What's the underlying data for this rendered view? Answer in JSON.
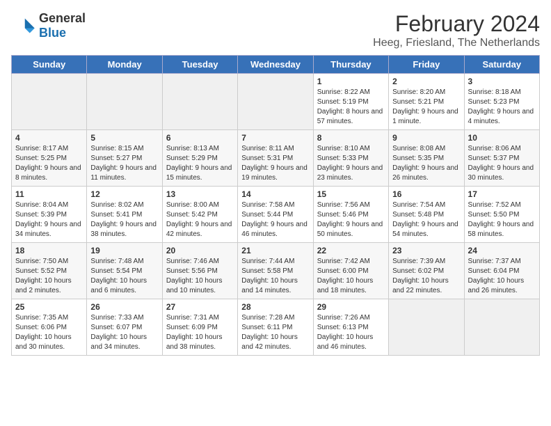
{
  "header": {
    "logo_general": "General",
    "logo_blue": "Blue",
    "month": "February 2024",
    "location": "Heeg, Friesland, The Netherlands"
  },
  "weekdays": [
    "Sunday",
    "Monday",
    "Tuesday",
    "Wednesday",
    "Thursday",
    "Friday",
    "Saturday"
  ],
  "weeks": [
    [
      {
        "day": "",
        "empty": true
      },
      {
        "day": "",
        "empty": true
      },
      {
        "day": "",
        "empty": true
      },
      {
        "day": "",
        "empty": true
      },
      {
        "day": "1",
        "sunrise": "8:22 AM",
        "sunset": "5:19 PM",
        "daylight": "8 hours and 57 minutes."
      },
      {
        "day": "2",
        "sunrise": "8:20 AM",
        "sunset": "5:21 PM",
        "daylight": "9 hours and 1 minute."
      },
      {
        "day": "3",
        "sunrise": "8:18 AM",
        "sunset": "5:23 PM",
        "daylight": "9 hours and 4 minutes."
      }
    ],
    [
      {
        "day": "4",
        "sunrise": "8:17 AM",
        "sunset": "5:25 PM",
        "daylight": "9 hours and 8 minutes."
      },
      {
        "day": "5",
        "sunrise": "8:15 AM",
        "sunset": "5:27 PM",
        "daylight": "9 hours and 11 minutes."
      },
      {
        "day": "6",
        "sunrise": "8:13 AM",
        "sunset": "5:29 PM",
        "daylight": "9 hours and 15 minutes."
      },
      {
        "day": "7",
        "sunrise": "8:11 AM",
        "sunset": "5:31 PM",
        "daylight": "9 hours and 19 minutes."
      },
      {
        "day": "8",
        "sunrise": "8:10 AM",
        "sunset": "5:33 PM",
        "daylight": "9 hours and 23 minutes."
      },
      {
        "day": "9",
        "sunrise": "8:08 AM",
        "sunset": "5:35 PM",
        "daylight": "9 hours and 26 minutes."
      },
      {
        "day": "10",
        "sunrise": "8:06 AM",
        "sunset": "5:37 PM",
        "daylight": "9 hours and 30 minutes."
      }
    ],
    [
      {
        "day": "11",
        "sunrise": "8:04 AM",
        "sunset": "5:39 PM",
        "daylight": "9 hours and 34 minutes."
      },
      {
        "day": "12",
        "sunrise": "8:02 AM",
        "sunset": "5:41 PM",
        "daylight": "9 hours and 38 minutes."
      },
      {
        "day": "13",
        "sunrise": "8:00 AM",
        "sunset": "5:42 PM",
        "daylight": "9 hours and 42 minutes."
      },
      {
        "day": "14",
        "sunrise": "7:58 AM",
        "sunset": "5:44 PM",
        "daylight": "9 hours and 46 minutes."
      },
      {
        "day": "15",
        "sunrise": "7:56 AM",
        "sunset": "5:46 PM",
        "daylight": "9 hours and 50 minutes."
      },
      {
        "day": "16",
        "sunrise": "7:54 AM",
        "sunset": "5:48 PM",
        "daylight": "9 hours and 54 minutes."
      },
      {
        "day": "17",
        "sunrise": "7:52 AM",
        "sunset": "5:50 PM",
        "daylight": "9 hours and 58 minutes."
      }
    ],
    [
      {
        "day": "18",
        "sunrise": "7:50 AM",
        "sunset": "5:52 PM",
        "daylight": "10 hours and 2 minutes."
      },
      {
        "day": "19",
        "sunrise": "7:48 AM",
        "sunset": "5:54 PM",
        "daylight": "10 hours and 6 minutes."
      },
      {
        "day": "20",
        "sunrise": "7:46 AM",
        "sunset": "5:56 PM",
        "daylight": "10 hours and 10 minutes."
      },
      {
        "day": "21",
        "sunrise": "7:44 AM",
        "sunset": "5:58 PM",
        "daylight": "10 hours and 14 minutes."
      },
      {
        "day": "22",
        "sunrise": "7:42 AM",
        "sunset": "6:00 PM",
        "daylight": "10 hours and 18 minutes."
      },
      {
        "day": "23",
        "sunrise": "7:39 AM",
        "sunset": "6:02 PM",
        "daylight": "10 hours and 22 minutes."
      },
      {
        "day": "24",
        "sunrise": "7:37 AM",
        "sunset": "6:04 PM",
        "daylight": "10 hours and 26 minutes."
      }
    ],
    [
      {
        "day": "25",
        "sunrise": "7:35 AM",
        "sunset": "6:06 PM",
        "daylight": "10 hours and 30 minutes."
      },
      {
        "day": "26",
        "sunrise": "7:33 AM",
        "sunset": "6:07 PM",
        "daylight": "10 hours and 34 minutes."
      },
      {
        "day": "27",
        "sunrise": "7:31 AM",
        "sunset": "6:09 PM",
        "daylight": "10 hours and 38 minutes."
      },
      {
        "day": "28",
        "sunrise": "7:28 AM",
        "sunset": "6:11 PM",
        "daylight": "10 hours and 42 minutes."
      },
      {
        "day": "29",
        "sunrise": "7:26 AM",
        "sunset": "6:13 PM",
        "daylight": "10 hours and 46 minutes."
      },
      {
        "day": "",
        "empty": true
      },
      {
        "day": "",
        "empty": true
      }
    ]
  ]
}
